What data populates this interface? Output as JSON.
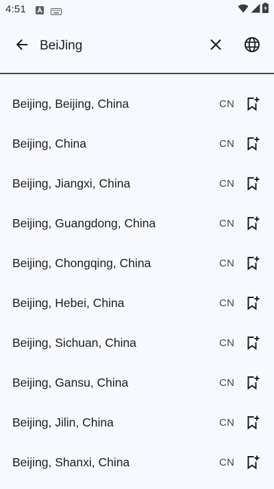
{
  "status_bar": {
    "time": "4:51",
    "icons": [
      "notification-a-icon",
      "keyboard-icon",
      "wifi-icon",
      "signal-icon",
      "battery-icon"
    ]
  },
  "toolbar": {
    "back_icon": "arrow-back-icon",
    "search_value": "BeiJing",
    "clear_icon": "close-icon",
    "language_icon": "globe-icon"
  },
  "results": [
    {
      "name": "Beijing, Beijing, China",
      "code": "CN"
    },
    {
      "name": "Beijing, China",
      "code": "CN"
    },
    {
      "name": "Beijing, Jiangxi, China",
      "code": "CN"
    },
    {
      "name": "Beijing, Guangdong, China",
      "code": "CN"
    },
    {
      "name": "Beijing, Chongqing, China",
      "code": "CN"
    },
    {
      "name": "Beijing, Hebei, China",
      "code": "CN"
    },
    {
      "name": "Beijing, Sichuan, China",
      "code": "CN"
    },
    {
      "name": "Beijing, Gansu, China",
      "code": "CN"
    },
    {
      "name": "Beijing, Jilin, China",
      "code": "CN"
    },
    {
      "name": "Beijing, Shanxi, China",
      "code": "CN"
    }
  ],
  "colors": {
    "background": "#f7f9ff",
    "text": "#1b1c20",
    "secondary_text": "#44464f",
    "divider": "#45464f"
  }
}
